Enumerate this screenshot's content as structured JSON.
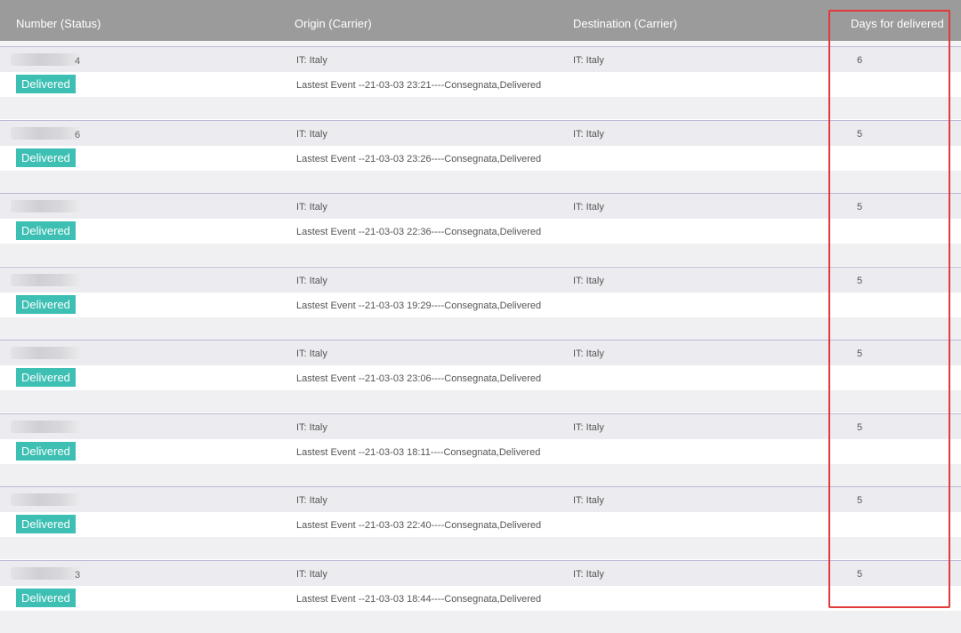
{
  "header": {
    "number": "Number (Status)",
    "origin": "Origin (Carrier)",
    "destination": "Destination (Carrier)",
    "days": "Days for delivered"
  },
  "rows": [
    {
      "number_tail": "4",
      "status": "Delivered",
      "origin": "IT: Italy",
      "destination": "IT: Italy",
      "days": "6",
      "event": "Lastest Event --21-03-03 23:21----Consegnata,Delivered"
    },
    {
      "number_tail": "6",
      "status": "Delivered",
      "origin": "IT: Italy",
      "destination": "IT: Italy",
      "days": "5",
      "event": "Lastest Event --21-03-03 23:26----Consegnata,Delivered"
    },
    {
      "number_tail": "",
      "status": "Delivered",
      "origin": "IT: Italy",
      "destination": "IT: Italy",
      "days": "5",
      "event": "Lastest Event --21-03-03 22:36----Consegnata,Delivered"
    },
    {
      "number_tail": "",
      "status": "Delivered",
      "origin": "IT: Italy",
      "destination": "IT: Italy",
      "days": "5",
      "event": "Lastest Event --21-03-03 19:29----Consegnata,Delivered"
    },
    {
      "number_tail": "",
      "status": "Delivered",
      "origin": "IT: Italy",
      "destination": "IT: Italy",
      "days": "5",
      "event": "Lastest Event --21-03-03 23:06----Consegnata,Delivered"
    },
    {
      "number_tail": "",
      "status": "Delivered",
      "origin": "IT: Italy",
      "destination": "IT: Italy",
      "days": "5",
      "event": "Lastest Event --21-03-03 18:11----Consegnata,Delivered"
    },
    {
      "number_tail": "",
      "status": "Delivered",
      "origin": "IT: Italy",
      "destination": "IT: Italy",
      "days": "5",
      "event": "Lastest Event --21-03-03 22:40----Consegnata,Delivered"
    },
    {
      "number_tail": "3",
      "status": "Delivered",
      "origin": "IT: Italy",
      "destination": "IT: Italy",
      "days": "5",
      "event": "Lastest Event --21-03-03 18:44----Consegnata,Delivered"
    }
  ],
  "colors": {
    "header_bg": "#9b9b9b",
    "badge": "#3dbfb3",
    "highlight": "#e03a3a"
  }
}
